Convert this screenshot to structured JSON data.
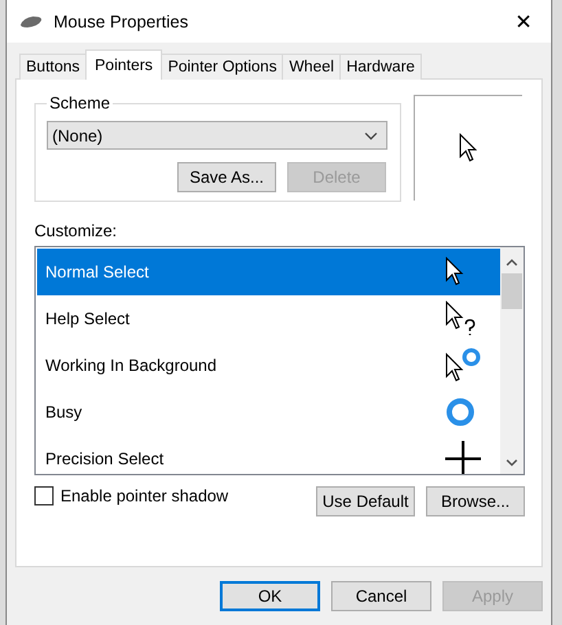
{
  "window": {
    "title": "Mouse Properties",
    "close": "✕"
  },
  "tabs": [
    {
      "label": "Buttons",
      "selected": false
    },
    {
      "label": "Pointers",
      "selected": true
    },
    {
      "label": "Pointer Options",
      "selected": false
    },
    {
      "label": "Wheel",
      "selected": false
    },
    {
      "label": "Hardware",
      "selected": false
    }
  ],
  "scheme": {
    "label": "Scheme",
    "value": "(None)",
    "buttons": [
      {
        "label": "Save As...",
        "disabled": false
      },
      {
        "label": "Delete",
        "disabled": true
      }
    ]
  },
  "customize": {
    "label": "Customize:",
    "items": [
      {
        "name": "Normal Select",
        "kind": "arrow",
        "selected": true
      },
      {
        "name": "Help Select",
        "kind": "help",
        "selected": false
      },
      {
        "name": "Working In Background",
        "kind": "working",
        "selected": false
      },
      {
        "name": "Busy",
        "kind": "busy",
        "selected": false
      },
      {
        "name": "Precision Select",
        "kind": "cross",
        "selected": false
      }
    ]
  },
  "shadow": {
    "label": "Enable pointer shadow",
    "checked": false
  },
  "pointer_buttons": [
    {
      "label": "Use Default"
    },
    {
      "label": "Browse..."
    }
  ],
  "buttons": [
    {
      "label": "OK",
      "disabled": false,
      "default": true
    },
    {
      "label": "Cancel",
      "disabled": false,
      "default": false
    },
    {
      "label": "Apply",
      "disabled": true,
      "default": false
    }
  ]
}
